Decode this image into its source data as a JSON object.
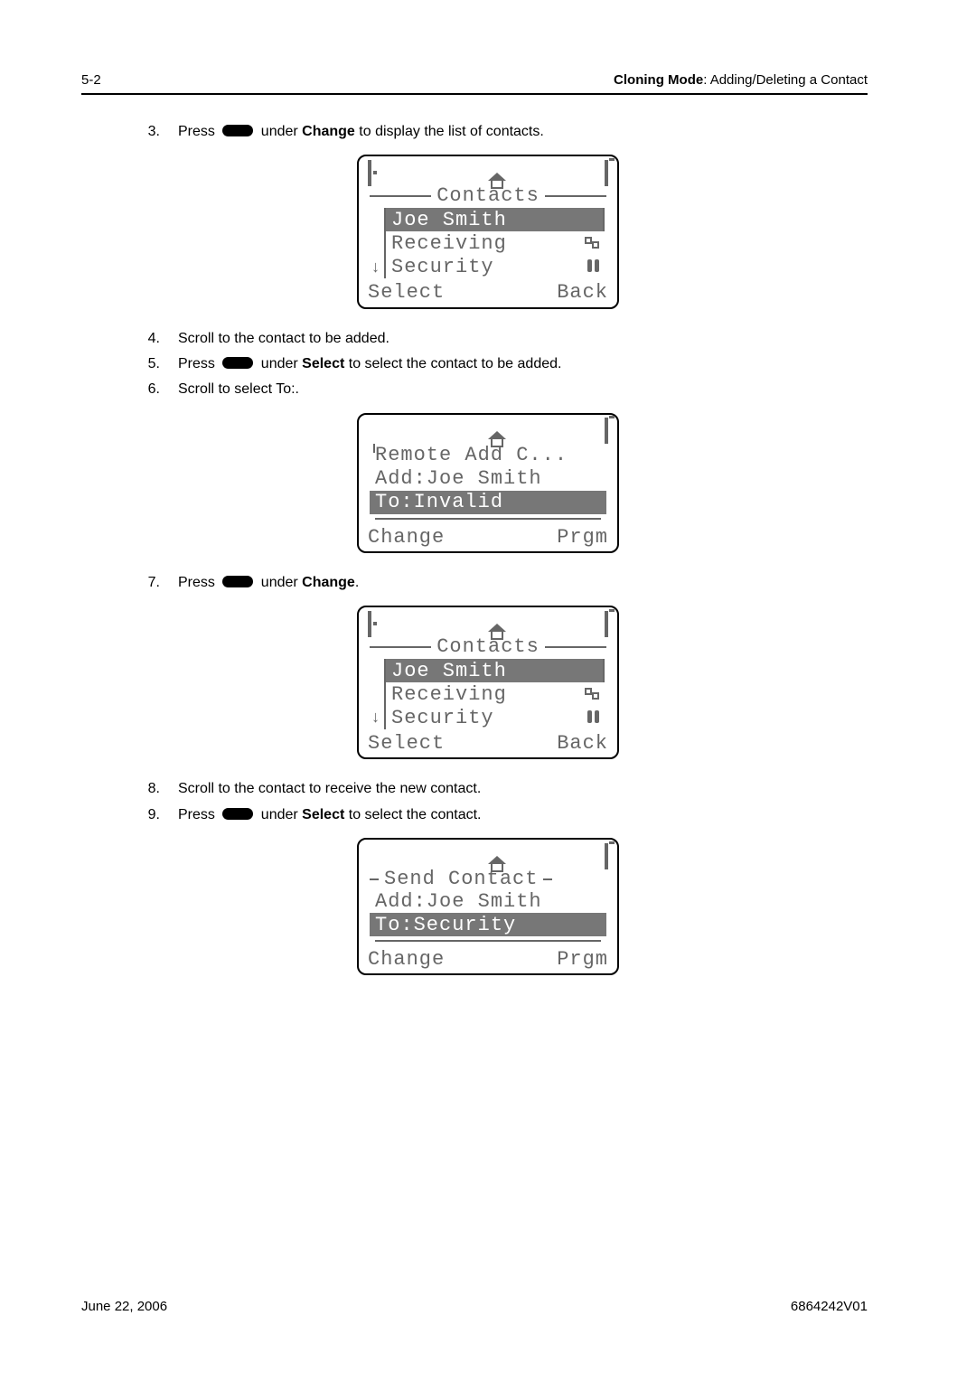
{
  "header": {
    "page_number": "5-2",
    "section_bold": "Cloning Mode",
    "section_rest": ": Adding/Deleting a Contact"
  },
  "steps": {
    "s3": {
      "num": "3.",
      "pre": "Press ",
      "post_under": " under ",
      "bold": "Change",
      "post": " to display the list of contacts."
    },
    "s4": {
      "num": "4.",
      "text": "Scroll to the contact to be added."
    },
    "s5": {
      "num": "5.",
      "pre": "Press ",
      "post_under": " under ",
      "bold": "Select",
      "post": " to select the contact to be added."
    },
    "s6": {
      "num": "6.",
      "text": "Scroll to select To:."
    },
    "s7": {
      "num": "7.",
      "pre": "Press ",
      "post_under": " under ",
      "bold": "Change",
      "post": "."
    },
    "s8": {
      "num": "8.",
      "text": "Scroll to the contact to receive the new contact."
    },
    "s9": {
      "num": "9.",
      "pre": "Press ",
      "post_under": " under ",
      "bold": "Select",
      "post": " to select the contact."
    }
  },
  "screen_contacts": {
    "title": "Contacts",
    "rows": [
      "Joe Smith",
      "Receiving",
      "Security"
    ],
    "soft_left": "Select",
    "soft_right": "Back"
  },
  "screen_remote_add": {
    "title": "Remote Add C...",
    "line1": "Add:Joe Smith",
    "line2": "To:Invalid",
    "soft_left": "Change",
    "soft_right": "Prgm"
  },
  "screen_send_contact": {
    "title": "Send Contact",
    "line1": "Add:Joe Smith",
    "line2": "To:Security",
    "soft_left": "Change",
    "soft_right": "Prgm"
  },
  "footer": {
    "date": "June 22, 2006",
    "docnum": "6864242V01"
  }
}
